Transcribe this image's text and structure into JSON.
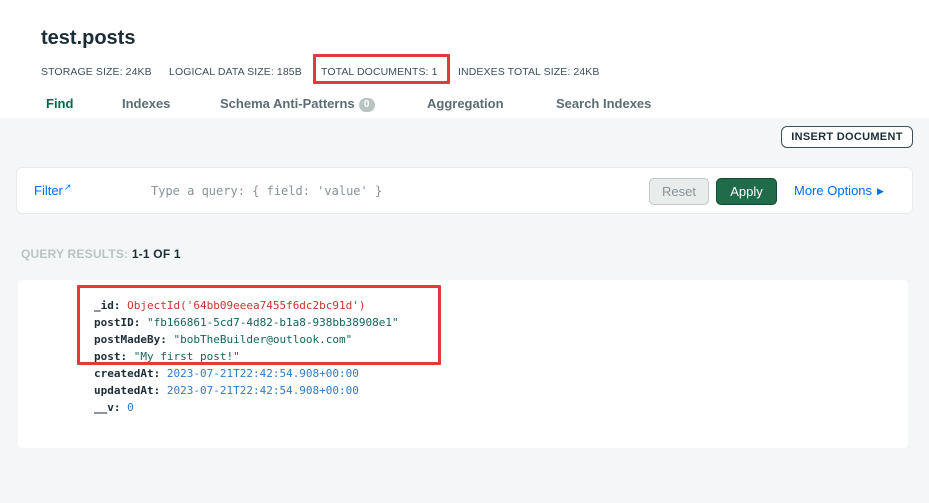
{
  "namespace": {
    "title": "test.posts"
  },
  "stats": [
    {
      "label": "STORAGE SIZE:",
      "value": "24KB"
    },
    {
      "label": "LOGICAL DATA SIZE:",
      "value": "185B"
    },
    {
      "label": "TOTAL DOCUMENTS:",
      "value": "1"
    },
    {
      "label": "INDEXES TOTAL SIZE:",
      "value": "24KB"
    }
  ],
  "tabs": [
    {
      "label": "Find"
    },
    {
      "label": "Indexes"
    },
    {
      "label": "Schema Anti-Patterns",
      "badge": "0"
    },
    {
      "label": "Aggregation"
    },
    {
      "label": "Search Indexes"
    }
  ],
  "toolbar": {
    "insert_label": "INSERT DOCUMENT"
  },
  "query": {
    "filter_label": "Filter",
    "placeholder": "Type a query: { field: 'value' }",
    "reset_label": "Reset",
    "apply_label": "Apply",
    "more_options_label": "More Options"
  },
  "results": {
    "label": "QUERY RESULTS:",
    "count": "1-1 OF 1"
  },
  "document": [
    {
      "key": "_id:",
      "value": "ObjectId('64bb09eeea7455f6dc2bc91d')",
      "kind": "oid"
    },
    {
      "key": "postID:",
      "value": "\"fb166861-5cd7-4d82-b1a8-938bb38908e1\"",
      "kind": "str"
    },
    {
      "key": "postMadeBy:",
      "value": "\"bobTheBuilder@outlook.com\"",
      "kind": "str"
    },
    {
      "key": "post:",
      "value": "\"My first post!\"",
      "kind": "str"
    },
    {
      "key": "createdAt:",
      "value": "2023-07-21T22:42:54.908+00:00",
      "kind": "date"
    },
    {
      "key": "updatedAt:",
      "value": "2023-07-21T22:42:54.908+00:00",
      "kind": "date"
    },
    {
      "key": "__v:",
      "value": "0",
      "kind": "num"
    }
  ],
  "colors": {
    "accent_green": "#00684a",
    "apply_green": "#1f6b4a",
    "link_blue": "#016bf8",
    "highlight_red": "#e03a3a"
  }
}
